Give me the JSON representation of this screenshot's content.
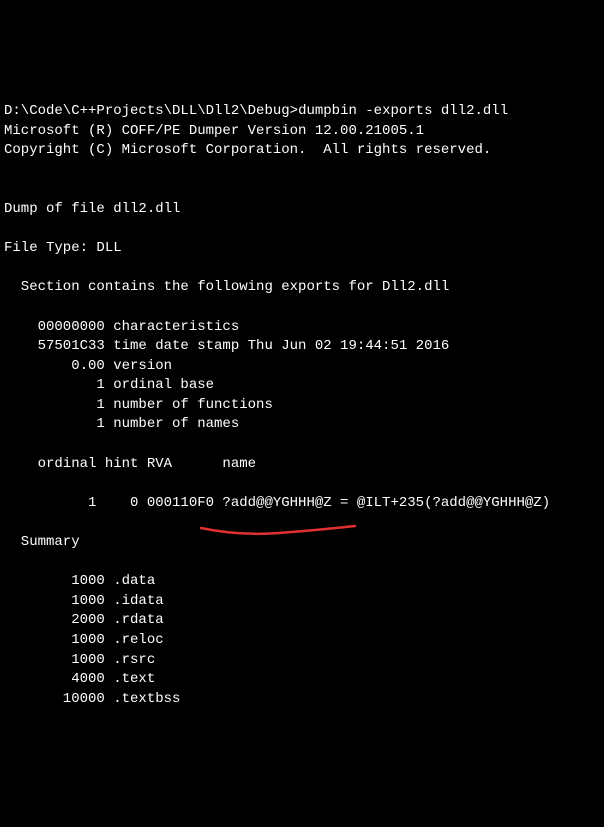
{
  "prompt": {
    "path": "D:\\Code\\C++Projects\\DLL\\Dll2\\Debug>",
    "command": "dumpbin -exports dll2.dll"
  },
  "header": {
    "line1": "Microsoft (R) COFF/PE Dumper Version 12.00.21005.1",
    "line2": "Copyright (C) Microsoft Corporation.  All rights reserved."
  },
  "dump": {
    "title": "Dump of file dll2.dll",
    "filetype": "File Type: DLL",
    "section_header": "  Section contains the following exports for Dll2.dll",
    "characteristics": "    00000000 characteristics",
    "timestamp": "    57501C33 time date stamp Thu Jun 02 19:44:51 2016",
    "version": "        0.00 version",
    "ordinal_base": "           1 ordinal base",
    "num_functions": "           1 number of functions",
    "num_names": "           1 number of names",
    "columns": "    ordinal hint RVA      name",
    "export_row": "          1    0 000110F0 ?add@@YGHHH@Z = @ILT+235(?add@@YGHHH@Z)"
  },
  "summary": {
    "title": "  Summary",
    "rows": [
      "        1000 .data",
      "        1000 .idata",
      "        2000 .rdata",
      "        1000 .reloc",
      "        1000 .rsrc",
      "        4000 .text",
      "       10000 .textbss"
    ]
  }
}
